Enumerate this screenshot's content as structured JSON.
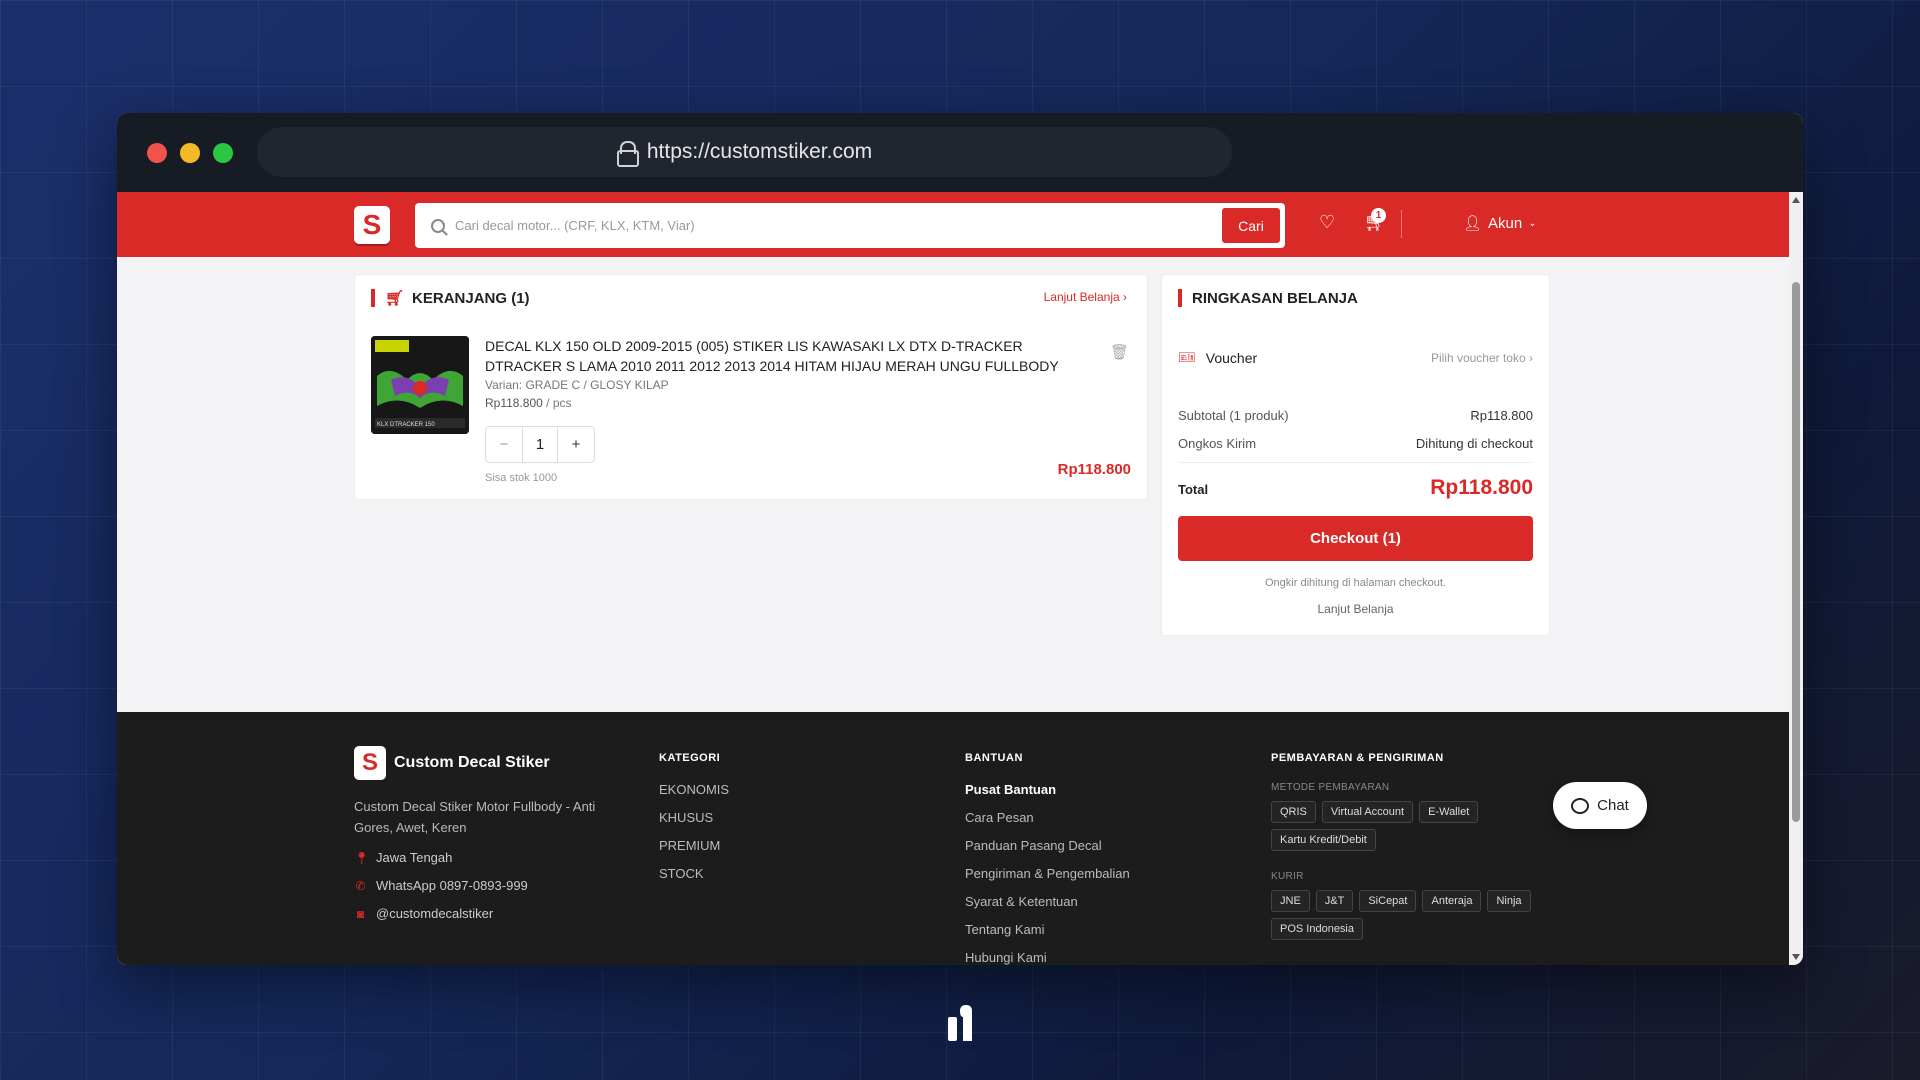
{
  "browser": {
    "url": "https://customstiker.com"
  },
  "header": {
    "logo": "S",
    "search_placeholder": "Cari decal motor... (CRF, KLX, KTM, Viar)",
    "search_button": "Cari",
    "cart_badge": "1",
    "account_label": "Akun"
  },
  "cart": {
    "title": "KERANJANG (1)",
    "continue_link": "Lanjut Belanja",
    "item": {
      "thumb_label": "KLX DTRACKER 150",
      "name": "DECAL KLX 150 OLD 2009-2015 (005) STIKER LIS KAWASAKI LX DTX D-TRACKER DTRACKER S LAMA 2010 2011 2012 2013 2014 HITAM HIJAU MERAH UNGU FULLBODY",
      "variant": "Varian: GRADE C / GLOSY KILAP",
      "unit_price": "Rp118.800",
      "unit_suffix": " / pcs",
      "quantity": "1",
      "stock": "Sisa stok 1000",
      "total_price": "Rp118.800"
    }
  },
  "summary": {
    "title": "RINGKASAN BELANJA",
    "voucher_label": "Voucher",
    "voucher_pick": "Pilih voucher toko",
    "subtotal_label": "Subtotal (1 produk)",
    "subtotal_value": "Rp118.800",
    "shipping_label": "Ongkos Kirim",
    "shipping_value": "Dihitung di checkout",
    "total_label": "Total",
    "total_value": "Rp118.800",
    "checkout_button": "Checkout (1)",
    "note": "Ongkir dihitung di halaman checkout.",
    "continue_link": "Lanjut Belanja"
  },
  "footer": {
    "brand": "Custom Decal Stiker",
    "logo": "S",
    "description": "Custom Decal Stiker Motor Fullbody - Anti Gores, Awet, Keren",
    "location": "Jawa Tengah",
    "whatsapp": "WhatsApp 0897-0893-999",
    "instagram": "@customdecalstiker",
    "kategori": {
      "title": "KATEGORI",
      "items": [
        "EKONOMIS",
        "KHUSUS",
        "PREMIUM",
        "STOCK"
      ]
    },
    "bantuan": {
      "title": "BANTUAN",
      "items": [
        "Pusat Bantuan",
        "Cara Pesan",
        "Panduan Pasang Decal",
        "Pengiriman & Pengembalian",
        "Syarat & Ketentuan",
        "Tentang Kami",
        "Hubungi Kami"
      ]
    },
    "payment": {
      "title": "PEMBAYARAN & PENGIRIMAN",
      "methods_label": "METODE PEMBAYARAN",
      "methods": [
        "QRIS",
        "Virtual Account",
        "E-Wallet",
        "Kartu Kredit/Debit"
      ],
      "courier_label": "KURIR",
      "couriers": [
        "JNE",
        "J&T",
        "SiCepat",
        "Anteraja",
        "Ninja",
        "POS Indonesia"
      ]
    }
  },
  "chat": {
    "label": "Chat"
  },
  "colors": {
    "accent": "#d92a27",
    "footer_bg": "#1c1c1c",
    "titlebar": "#171b23"
  }
}
